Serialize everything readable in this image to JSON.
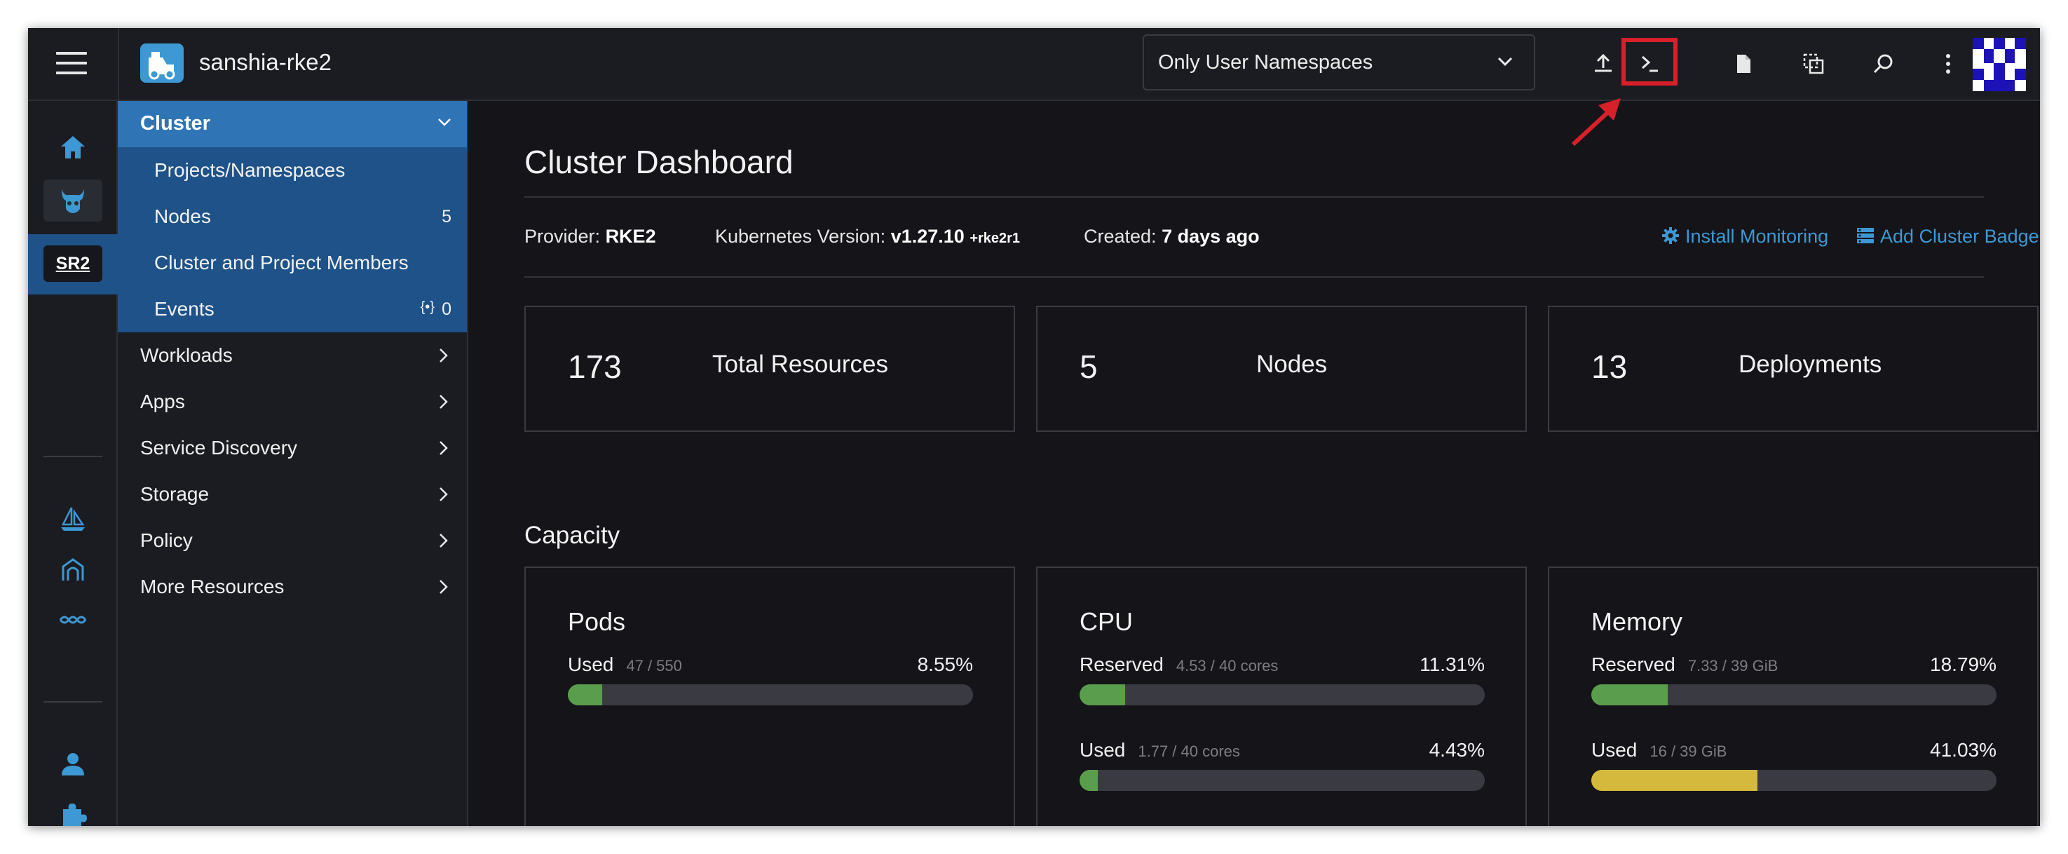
{
  "header": {
    "cluster_name": "sanshia-rke2",
    "namespace_filter": "Only User Namespaces"
  },
  "rail": {
    "active_cluster_badge": "SR2"
  },
  "sidenav": {
    "cluster_group": {
      "label": "Cluster",
      "items": [
        {
          "label": "Projects/Namespaces",
          "count": ""
        },
        {
          "label": "Nodes",
          "count": "5"
        },
        {
          "label": "Cluster and Project Members",
          "count": ""
        },
        {
          "label": "Events",
          "count": "0"
        }
      ]
    },
    "groups": [
      {
        "label": "Workloads"
      },
      {
        "label": "Apps"
      },
      {
        "label": "Service Discovery"
      },
      {
        "label": "Storage"
      },
      {
        "label": "Policy"
      },
      {
        "label": "More Resources"
      }
    ]
  },
  "main": {
    "title": "Cluster Dashboard",
    "provider_label": "Provider:",
    "provider_value": "RKE2",
    "k8s_label": "Kubernetes Version:",
    "k8s_value": "v1.27.10",
    "k8s_suffix": "+rke2r1",
    "created_label": "Created:",
    "created_value": "7 days ago",
    "install_monitoring": "Install Monitoring",
    "add_cluster_badge": "Add Cluster Badge",
    "stats": [
      {
        "value": "173",
        "label": "Total Resources"
      },
      {
        "value": "5",
        "label": "Nodes"
      },
      {
        "value": "13",
        "label": "Deployments"
      }
    ],
    "capacity_title": "Capacity",
    "capacity": {
      "pods": {
        "title": "Pods",
        "used": {
          "label": "Used",
          "detail": "47 / 550",
          "percent": "8.55%",
          "fraction": 0.0855
        }
      },
      "cpu": {
        "title": "CPU",
        "reserved": {
          "label": "Reserved",
          "detail": "4.53 / 40 cores",
          "percent": "11.31%",
          "fraction": 0.1131
        },
        "used": {
          "label": "Used",
          "detail": "1.77 / 40 cores",
          "percent": "4.43%",
          "fraction": 0.0443
        }
      },
      "memory": {
        "title": "Memory",
        "reserved": {
          "label": "Reserved",
          "detail": "7.33 / 39 GiB",
          "percent": "18.79%",
          "fraction": 0.1879
        },
        "used": {
          "label": "Used",
          "detail": "16 / 39 GiB",
          "percent": "41.03%",
          "fraction": 0.4103
        }
      }
    }
  },
  "colors": {
    "accent": "#3d98d3",
    "nav_active": "#2f74b5",
    "bar_green": "#5a9e4d",
    "bar_yellow": "#d4b93c",
    "highlight_red": "#d8202b"
  }
}
